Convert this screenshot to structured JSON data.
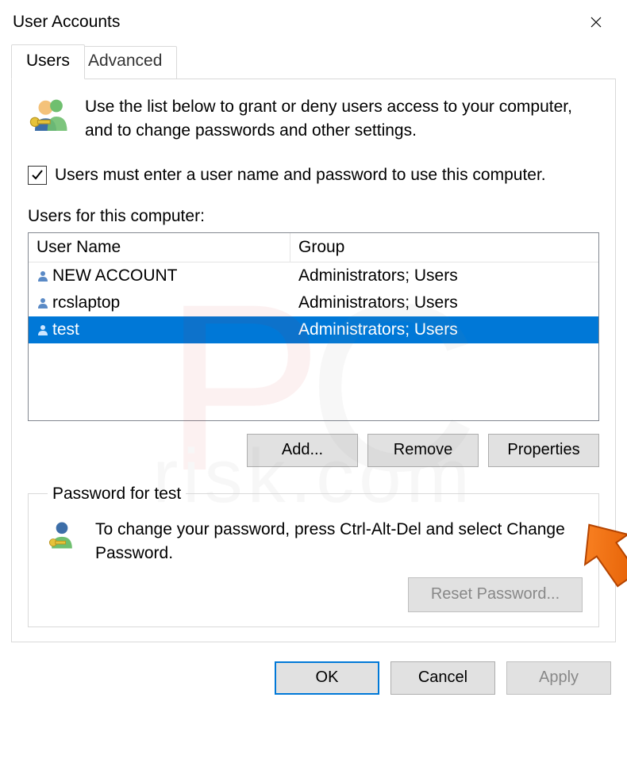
{
  "window": {
    "title": "User Accounts"
  },
  "tabs": {
    "users": "Users",
    "advanced": "Advanced"
  },
  "hint": "Use the list below to grant or deny users access to your computer, and to change passwords and other settings.",
  "checkbox": {
    "label": "Users must enter a user name and password to use this computer.",
    "checked": true
  },
  "list": {
    "caption": "Users for this computer:",
    "columns": {
      "user": "User Name",
      "group": "Group"
    },
    "rows": [
      {
        "user": "NEW ACCOUNT",
        "group": "Administrators; Users",
        "selected": false
      },
      {
        "user": "rcslaptop",
        "group": "Administrators; Users",
        "selected": false
      },
      {
        "user": "test",
        "group": "Administrators; Users",
        "selected": true
      }
    ]
  },
  "buttons": {
    "add": "Add...",
    "remove": "Remove",
    "properties": "Properties",
    "reset": "Reset Password...",
    "ok": "OK",
    "cancel": "Cancel",
    "apply": "Apply"
  },
  "password_group": {
    "legend": "Password for test",
    "text": "To change your password, press Ctrl-Alt-Del and select Change Password."
  },
  "watermark": {
    "big_left": "P",
    "big_right": "C",
    "sub": "risk.com"
  }
}
